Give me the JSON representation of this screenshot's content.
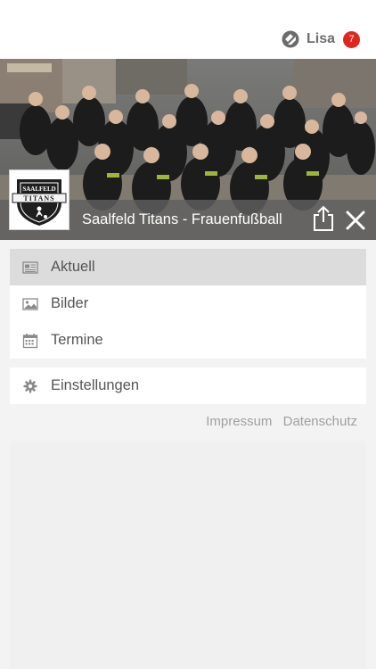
{
  "header": {
    "user_name": "Lisa",
    "notification_count": "7"
  },
  "club": {
    "title": "Saalfeld Titans - Frauenfußball",
    "logo_top_text": "SAALFELD",
    "logo_bottom_text": "TITANS"
  },
  "menu": {
    "items": [
      {
        "label": "Aktuell",
        "icon": "newspaper-icon"
      },
      {
        "label": "Bilder",
        "icon": "image-icon"
      },
      {
        "label": "Termine",
        "icon": "calendar-icon"
      }
    ],
    "settings_label": "Einstellungen"
  },
  "footer": {
    "impressum": "Impressum",
    "datenschutz": "Datenschutz"
  },
  "colors": {
    "badge": "#e0261e",
    "active_item": "#dcdcdc"
  }
}
